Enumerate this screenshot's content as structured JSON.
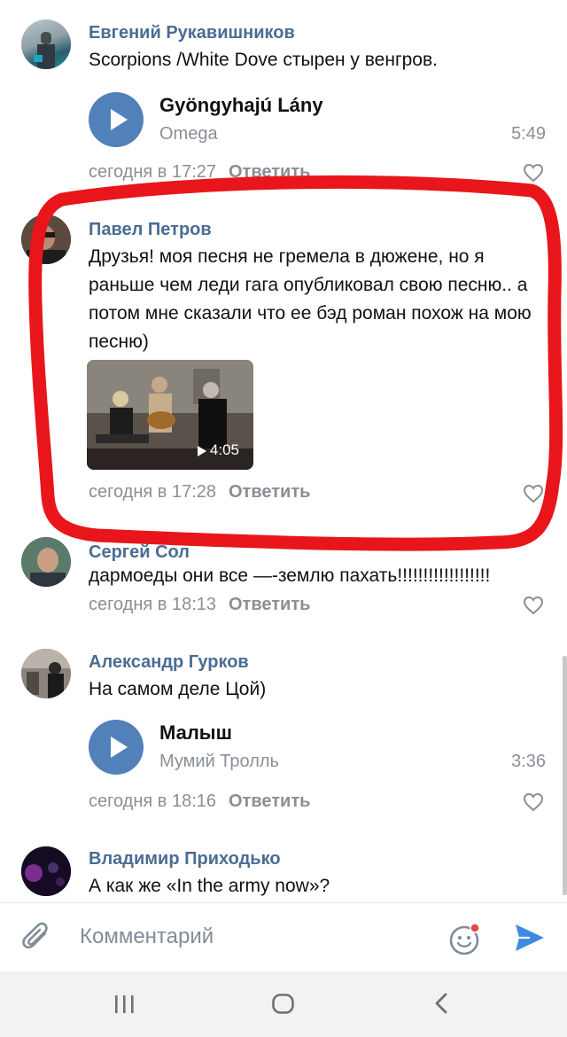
{
  "comments": [
    {
      "author": "Евгений Рукавишников",
      "text": "Scorpions /White Dove стырен у венгров.",
      "audio": {
        "title": "Gyöngyhajú Lány",
        "artist": "Omega",
        "duration": "5:49"
      },
      "time": "сегодня в 17:27",
      "reply": "Ответить"
    },
    {
      "author": "Павел Петров",
      "text": "Друзья! моя песня не гремела в дюжене, но я раньше чем леди гага опубликовал свою песню.. а потом мне сказали что ее бэд роман похож на мою песню)",
      "video": {
        "duration": "4:05"
      },
      "time": "сегодня в 17:28",
      "reply": "Ответить"
    },
    {
      "author": "Сергей Сол",
      "text": "дармоеды они все —-землю пахать!!!!!!!!!!!!!!!!!!",
      "time": "сегодня в 18:13",
      "reply": "Ответить"
    },
    {
      "author": "Александр Гурков",
      "text": "На самом деле Цой)",
      "audio": {
        "title": "Малыш",
        "artist": "Мумий Тролль",
        "duration": "3:36"
      },
      "time": "сегодня в 18:16",
      "reply": "Ответить"
    },
    {
      "author": "Владимир Приходько",
      "text": "А как же «In the army now»?"
    }
  ],
  "input": {
    "placeholder": "Комментарий"
  },
  "colors": {
    "accent": "#5181b8",
    "author": "#4a6d93",
    "meta": "#8a8f96",
    "annotation": "#e8161b"
  },
  "icons": {
    "attach": "paperclip-icon",
    "emoji": "smile-icon",
    "send": "send-icon",
    "like": "heart-outline-icon",
    "nav": [
      "recent-apps-icon",
      "home-icon",
      "back-icon"
    ]
  }
}
